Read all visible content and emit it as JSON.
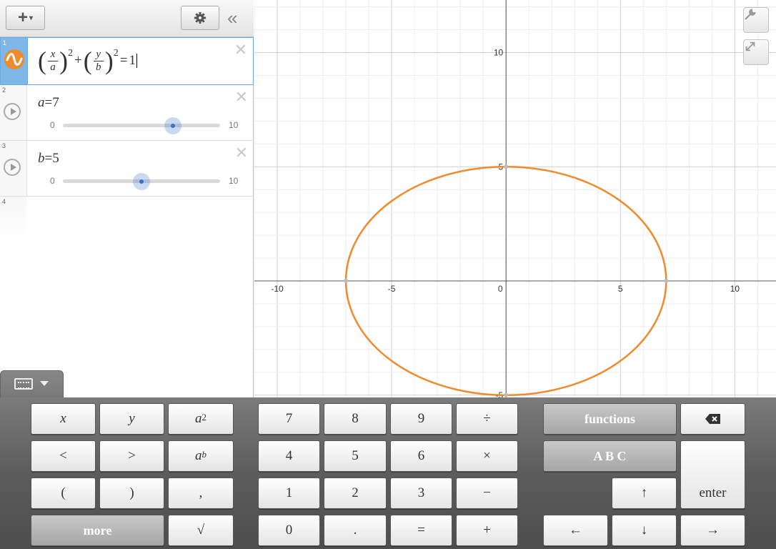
{
  "topbar": {
    "add_label": "+",
    "add_caret": "▾",
    "settings_icon": "gear-icon",
    "collapse_label": "«"
  },
  "expressions": [
    {
      "index": "1",
      "eq_x": "x",
      "eq_a": "a",
      "eq_y": "y",
      "eq_b": "b",
      "exp": "2",
      "plus": "+",
      "eq": "=",
      "rhs": "1",
      "color": "#ef8a2d"
    },
    {
      "index": "2",
      "lhs": "a",
      "eq": "=",
      "value": "7",
      "min": "0",
      "max": "10",
      "fraction": 0.7
    },
    {
      "index": "3",
      "lhs": "b",
      "eq": "=",
      "value": "5",
      "min": "0",
      "max": "10",
      "fraction": 0.5
    },
    {
      "index": "4"
    }
  ],
  "close_label": "✕",
  "graph": {
    "x_range": [
      -11.0,
      11.8
    ],
    "y_range": [
      -5.1,
      12.3
    ],
    "grid_step": 1,
    "major_step": 5,
    "x_ticks": [
      "-10",
      "-5",
      "0",
      "5",
      "10"
    ],
    "y_ticks": [
      "10",
      "5",
      "-5"
    ],
    "curve": {
      "type": "ellipse",
      "a": 7,
      "b": 5,
      "color": "#ef8a2d"
    }
  },
  "keypad": {
    "x": "x",
    "y": "y",
    "a": "a",
    "two": "2",
    "b": "b",
    "lt": "<",
    "gt": ">",
    "lparen": "(",
    "rparen": ")",
    "comma": ",",
    "more": "more",
    "sqrt": "√",
    "k7": "7",
    "k8": "8",
    "k9": "9",
    "div": "÷",
    "k4": "4",
    "k5": "5",
    "k6": "6",
    "mul": "×",
    "k1": "1",
    "k2": "2",
    "k3": "3",
    "minus": "−",
    "k0": "0",
    "dot": ".",
    "equals": "=",
    "plus": "+",
    "functions": "functions",
    "abc": "A B C",
    "backspace": "⌫",
    "up": "↑",
    "enter": "enter",
    "left": "←",
    "down": "↓",
    "right": "→"
  }
}
